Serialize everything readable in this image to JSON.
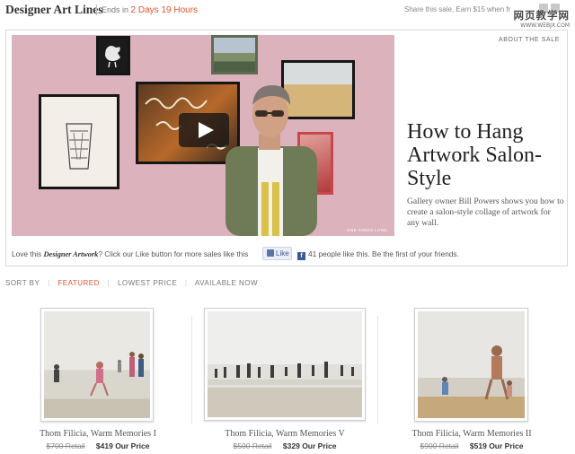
{
  "header": {
    "brand": "Designer Art Lines",
    "ends_prefix": "Ends in",
    "countdown": "2 Days 19 Hours",
    "share_text": "Share this sale, Earn $15 when fr",
    "watermark_main": "网页教学网",
    "watermark_sub": "WWW.WEBJX.COM"
  },
  "feature": {
    "about_link": "ABOUT THE SALE",
    "headline": "How to Hang Artwork Salon-Style",
    "description": "Gallery owner Bill Powers shows you how to create a salon-style collage of artwork for any wall.",
    "video_logo": "ONE KINGS LANE",
    "like_prompt_prefix": "Love this",
    "like_prompt_em": "Designer Artwork",
    "like_prompt_suffix": "? Click our Like button for more sales like this",
    "like_button": "Like",
    "like_count_text": "41 people like this. Be the first of your friends."
  },
  "sort": {
    "label": "SORT BY",
    "options": [
      "FEATURED",
      "LOWEST PRICE",
      "AVAILABLE NOW"
    ],
    "active": "FEATURED"
  },
  "products": [
    {
      "name": "Thom Filicia, Warm Memories I",
      "retail": "$700 Retail",
      "price": "$419 Our Price"
    },
    {
      "name": "Thom Filicia, Warm Memories V",
      "retail": "$500 Retail",
      "price": "$329 Our Price"
    },
    {
      "name": "Thom Filicia, Warm Memories II",
      "retail": "$900 Retail",
      "price": "$519 Our Price"
    }
  ],
  "colors": {
    "accent": "#e0552b",
    "wall": "#dcb3bd",
    "facebook": "#3b5998"
  }
}
